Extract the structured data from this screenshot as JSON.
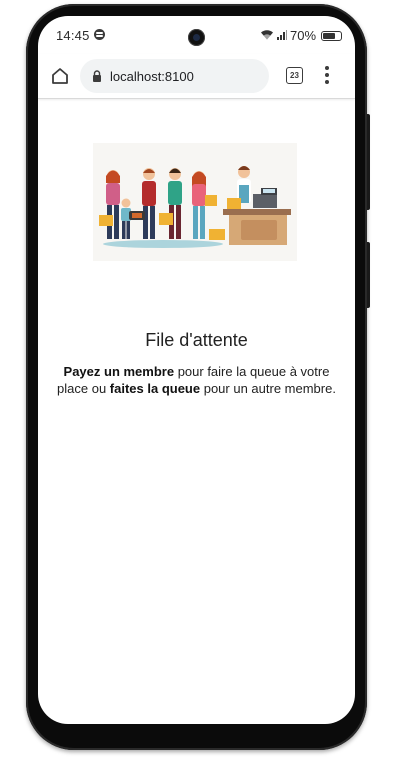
{
  "status_bar": {
    "time": "14:45",
    "battery": "70%",
    "icons": [
      "spotify-icon",
      "wifi-icon",
      "signal-icon",
      "battery-icon"
    ]
  },
  "browser": {
    "url": "localhost:8100",
    "tab_count": "23",
    "icons": [
      "home-icon",
      "lock-icon",
      "tabs-icon",
      "more-menu-icon"
    ]
  },
  "page": {
    "title": "File d'attente",
    "desc_bold_1": "Payez un membre",
    "desc_text_1": " pour faire la queue à votre place ou ",
    "desc_bold_2": "faites la queue",
    "desc_text_2": " pour un autre membre."
  },
  "colors": {
    "frame": "#0b0b0b",
    "url_bar_bg": "#f1f3f4",
    "text": "#222222"
  }
}
